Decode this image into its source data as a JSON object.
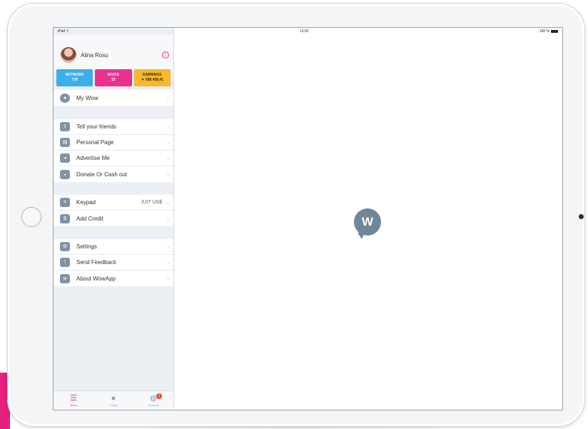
{
  "status_bar": {
    "carrier": "iPad ⌔",
    "time": "12:52",
    "battery": "100 %"
  },
  "profile": {
    "name": "Alina Rosu",
    "info_glyph": "ⓘ"
  },
  "stats": [
    {
      "label": "NETWORK",
      "value": "778"
    },
    {
      "label": "INVITE",
      "value": "22"
    },
    {
      "label": "EARNINGS",
      "value": "▼ 588.458,41"
    }
  ],
  "menu_groups": [
    [
      {
        "label": "My Wow",
        "icon": "chat-bubble-icon"
      }
    ],
    [
      {
        "label": "Tell your friends",
        "icon": "share-icon"
      },
      {
        "label": "Personal Page",
        "icon": "id-card-icon"
      },
      {
        "label": "Advertise Me",
        "icon": "megaphone-icon"
      },
      {
        "label": "Donate Or Cash out",
        "icon": "donate-icon"
      }
    ],
    [
      {
        "label": "Keypad",
        "icon": "keypad-icon",
        "value": "3,07 US$"
      },
      {
        "label": "Add Credit",
        "icon": "dollar-icon"
      }
    ],
    [
      {
        "label": "Settings",
        "icon": "gear-icon"
      },
      {
        "label": "Send Feedback",
        "icon": "feedback-icon"
      },
      {
        "label": "About WowApp",
        "icon": "about-icon"
      }
    ]
  ],
  "tabbar": [
    {
      "label": "Menu",
      "icon": "menu-icon",
      "active": true
    },
    {
      "label": "Chats",
      "icon": "chats-icon"
    },
    {
      "label": "Contacts",
      "icon": "contacts-icon",
      "badge": "1"
    }
  ],
  "logo_text": "W",
  "colors": {
    "accent": "#e8438f",
    "network": "#3daee9",
    "invite": "#e8328d",
    "earnings": "#f5b82e",
    "icon": "#7f93a6"
  }
}
